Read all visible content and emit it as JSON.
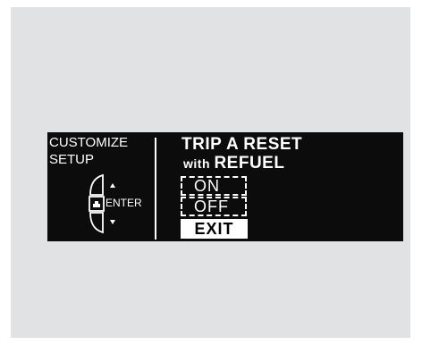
{
  "menu": {
    "line1": "CUSTOMIZE",
    "line2": "SETUP"
  },
  "control": {
    "enter_label": "ENTER",
    "icons": [
      "up-arrow-icon",
      "enter-button-icon",
      "down-arrow-icon"
    ]
  },
  "screen": {
    "title": "TRIP A RESET",
    "subtitle_prefix": "with",
    "subtitle_main": "REFUEL",
    "options": [
      {
        "label": "ON"
      },
      {
        "label": "OFF"
      }
    ],
    "exit_label": "EXIT"
  },
  "colors": {
    "background": "#e1e2e3",
    "display": "#0c0c0c",
    "text": "#ffffff"
  }
}
